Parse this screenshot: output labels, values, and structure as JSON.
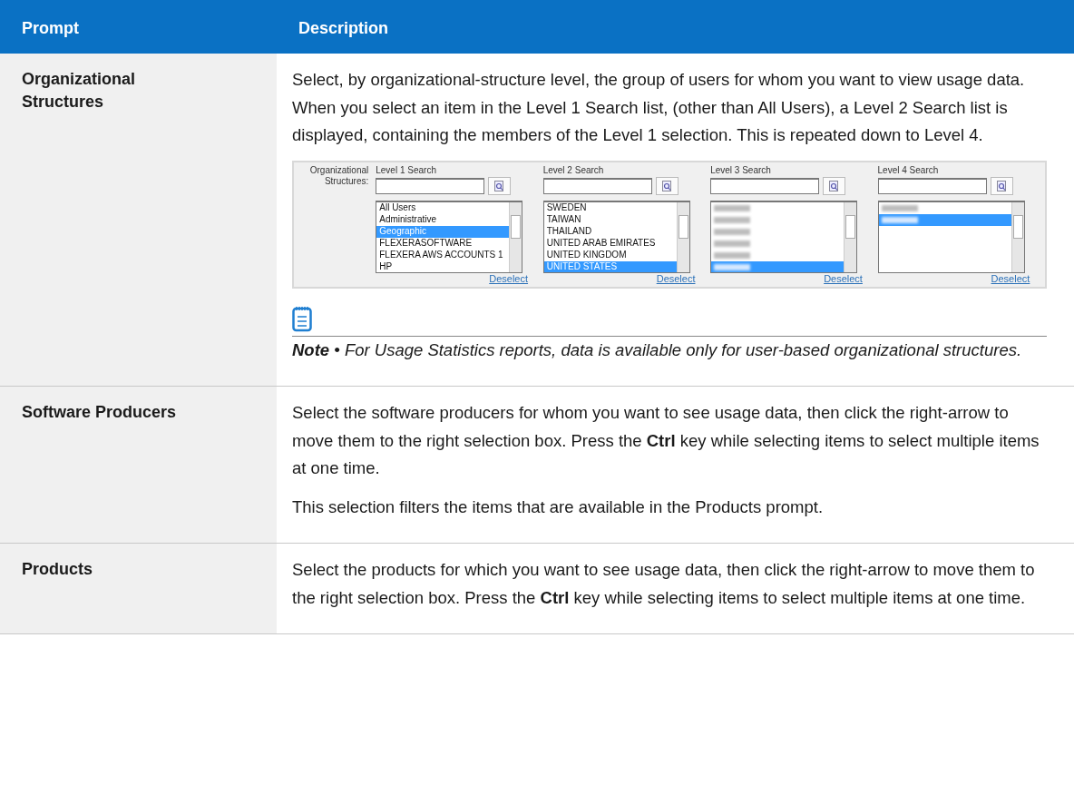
{
  "table": {
    "columns": [
      "Prompt",
      "Description"
    ],
    "rows": [
      {
        "prompt": "Organizational Structures",
        "paragraphs": [
          "Select, by organizational-structure level, the group of users for whom you want to view usage data. When you select an item in the Level 1 Search list, (other than All Users), a Level 2 Search list is displayed, containing the members of the Level 1 selection. This is repeated down to Level 4."
        ],
        "screenshot": {
          "label": "Organizational Structures:",
          "levels": [
            {
              "title": "Level 1 Search",
              "link": "Deselect",
              "items": [
                {
                  "text": "All Users",
                  "selected": false
                },
                {
                  "text": "Administrative",
                  "selected": false
                },
                {
                  "text": "Geographic",
                  "selected": true
                },
                {
                  "text": "FLEXERASOFTWARE",
                  "selected": false
                },
                {
                  "text": "FLEXERA AWS ACCOUNTS 1",
                  "selected": false
                },
                {
                  "text": "HP",
                  "selected": false
                }
              ]
            },
            {
              "title": "Level 2 Search",
              "link": "Deselect",
              "items": [
                {
                  "text": "SWEDEN",
                  "selected": false
                },
                {
                  "text": "TAIWAN",
                  "selected": false
                },
                {
                  "text": "THAILAND",
                  "selected": false
                },
                {
                  "text": "UNITED ARAB EMIRATES",
                  "selected": false
                },
                {
                  "text": "UNITED KINGDOM",
                  "selected": false
                },
                {
                  "text": "UNITED STATES",
                  "selected": true
                }
              ]
            },
            {
              "title": "Level 3 Search",
              "link": "Deselect",
              "items": [
                {
                  "redacted": true,
                  "selected": false
                },
                {
                  "redacted": true,
                  "selected": false
                },
                {
                  "redacted": true,
                  "selected": false
                },
                {
                  "redacted": true,
                  "selected": false
                },
                {
                  "redacted": true,
                  "selected": false
                },
                {
                  "redacted": true,
                  "selected": true
                }
              ]
            },
            {
              "title": "Level 4 Search",
              "link": "Deselect",
              "items": [
                {
                  "redacted": true,
                  "selected": false
                },
                {
                  "redacted": true,
                  "selected": true
                }
              ]
            }
          ]
        },
        "note": "**Note** • For Usage Statistics reports, data is available only for user-based organizational structures."
      },
      {
        "prompt": "Software Producers",
        "paragraphs": [
          "Select the software producers for whom you want to see usage data, then click the right-arrow to move them to the right selection box. Press the **Ctrl** key while selecting items to select multiple items at one time.",
          "This selection filters the items that are available in the Products prompt."
        ]
      },
      {
        "prompt": "Products",
        "paragraphs": [
          "Select the products for which you want to see usage data, then click the right-arrow to move them to the right selection box. Press the **Ctrl** key while selecting items to select multiple items at one time."
        ]
      }
    ]
  }
}
